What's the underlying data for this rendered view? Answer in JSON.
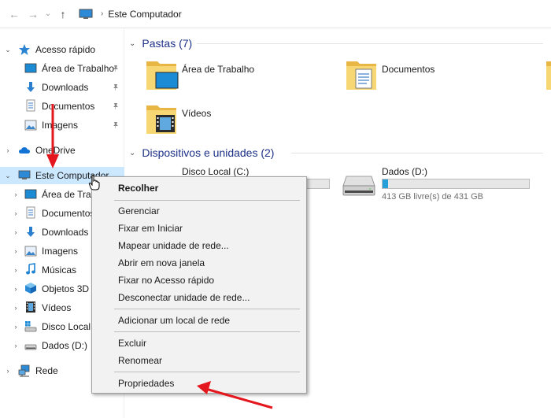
{
  "addressbar": {
    "back": "←",
    "forward": "→",
    "history": "⌄",
    "up": "↑",
    "crumbs": [
      "Este Computador"
    ]
  },
  "sidebar": {
    "quick_access": "Acesso rápido",
    "quick_items": [
      "Área de Trabalho",
      "Downloads",
      "Documentos",
      "Imagens"
    ],
    "onedrive": "OneDrive",
    "this_pc": "Este Computador",
    "pc_items": [
      "Área de Trabalho",
      "Documentos",
      "Downloads",
      "Imagens",
      "Músicas",
      "Objetos 3D",
      "Vídeos",
      "Disco Local (C:)",
      "Dados (D:)"
    ],
    "network": "Rede"
  },
  "main": {
    "folders_header": "Pastas (7)",
    "folders": [
      "Área de Trabalho",
      "Documentos",
      "Vídeos"
    ],
    "devices_header": "Dispositivos e unidades (2)",
    "drives": [
      {
        "name": "Disco Local (C:)",
        "free": "",
        "used_fraction": 0.75
      },
      {
        "name": "Dados (D:)",
        "free": "413 GB livre(s) de 431 GB",
        "used_fraction": 0.04
      }
    ]
  },
  "context_menu": {
    "items": [
      "Recolher",
      "Gerenciar",
      "Fixar em Iniciar",
      "Mapear unidade de rede...",
      "Abrir em nova janela",
      "Fixar no Acesso rápido",
      "Desconectar unidade de rede...",
      "Adicionar um local de rede",
      "Excluir",
      "Renomear",
      "Propriedades"
    ]
  },
  "colors": {
    "accent": "#26a0da",
    "selection": "#cce8ff",
    "header_blue": "#1e3287",
    "annotation_red": "#e3171d"
  }
}
